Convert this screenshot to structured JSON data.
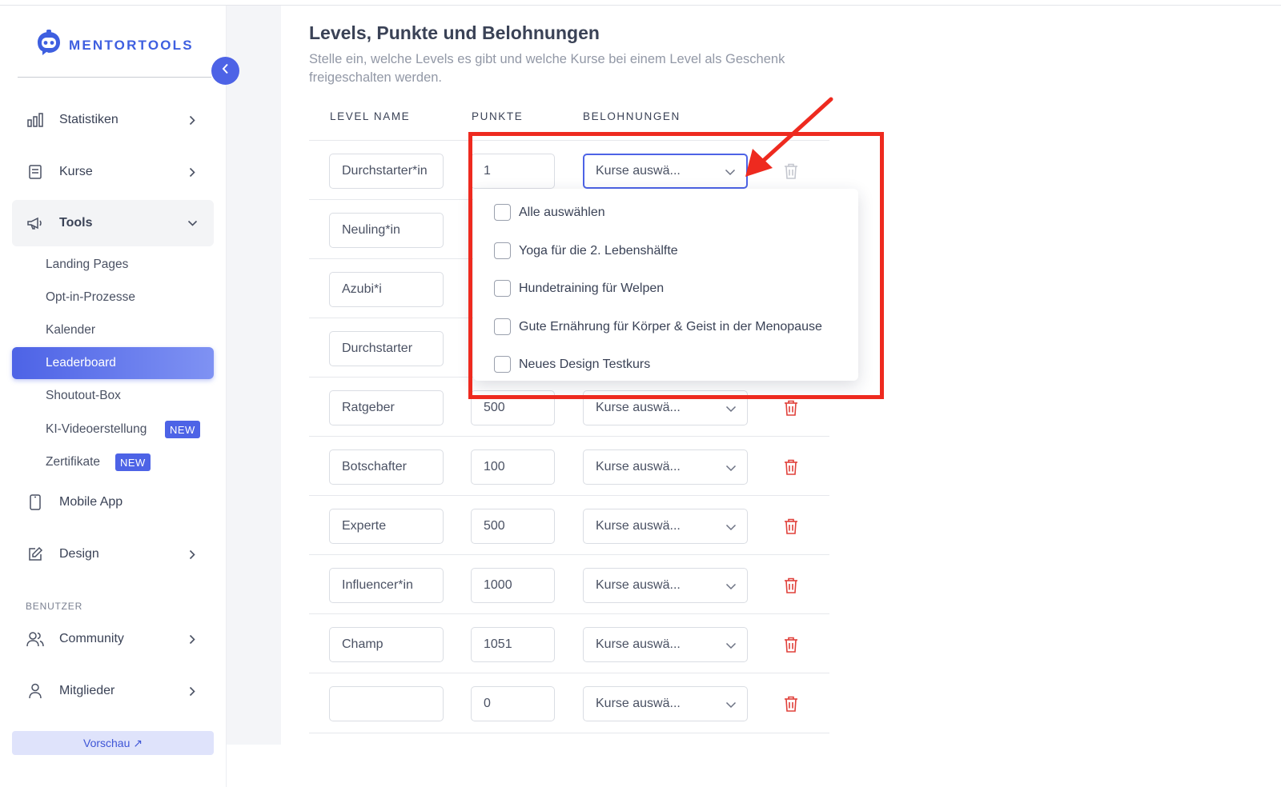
{
  "brand": {
    "name": "MENTORTOOLS",
    "accent": "#4d63e6",
    "annotation_color": "#ee2a1f"
  },
  "sidebar": {
    "nav": [
      {
        "label": "Statistiken",
        "icon": "bar-chart-icon"
      },
      {
        "label": "Kurse",
        "icon": "book-icon"
      },
      {
        "label": "Tools",
        "icon": "megaphone-icon"
      }
    ],
    "tools_sub": [
      {
        "label": "Landing Pages"
      },
      {
        "label": "Opt-in-Prozesse"
      },
      {
        "label": "Kalender"
      },
      {
        "label": "Leaderboard"
      },
      {
        "label": "Shoutout-Box"
      },
      {
        "label": "KI-Videoerstellung",
        "badge": "NEW"
      },
      {
        "label": "Zertifikate",
        "badge": "NEW"
      }
    ],
    "more_nav": [
      {
        "label": "Mobile App",
        "icon": "phone-icon"
      },
      {
        "label": "Design",
        "icon": "pencil-icon"
      }
    ],
    "section_label": "BENUTZER",
    "user_nav": [
      {
        "label": "Community",
        "icon": "users-icon"
      },
      {
        "label": "Mitglieder",
        "icon": "user-icon"
      }
    ],
    "preview_label": "Vorschau ↗"
  },
  "main": {
    "title": "Levels, Punkte und Belohnungen",
    "subtitle": "Stelle ein, welche Levels es gibt und welche Kurse bei einem Level als Geschenk freigeschalten werden.",
    "columns": {
      "name": "LEVEL NAME",
      "points": "PUNKTE",
      "rewards": "BELOHNUNGEN"
    },
    "select_placeholder": "Kurse auswä...",
    "rows": [
      {
        "name": "Durchstarter*in",
        "points": "1"
      },
      {
        "name": "Neuling*in",
        "points": ""
      },
      {
        "name": "Azubi*i",
        "points": ""
      },
      {
        "name": "Durchstarter",
        "points": ""
      },
      {
        "name": "Ratgeber",
        "points": "500"
      },
      {
        "name": "Botschafter",
        "points": "100"
      },
      {
        "name": "Experte",
        "points": "500"
      },
      {
        "name": "Influencer*in",
        "points": "1000"
      },
      {
        "name": "Champ",
        "points": "1051"
      },
      {
        "name": "",
        "points": "0"
      }
    ],
    "dropdown_options": [
      {
        "label": "Alle auswählen",
        "checked": false
      },
      {
        "label": "Yoga für die 2. Lebenshälfte",
        "checked": false
      },
      {
        "label": "Hundetraining für Welpen",
        "checked": false
      },
      {
        "label": "Gute Ernährung für Körper & Geist in der Menopause",
        "checked": false
      },
      {
        "label": "Neues Design Testkurs",
        "checked": false
      }
    ]
  }
}
